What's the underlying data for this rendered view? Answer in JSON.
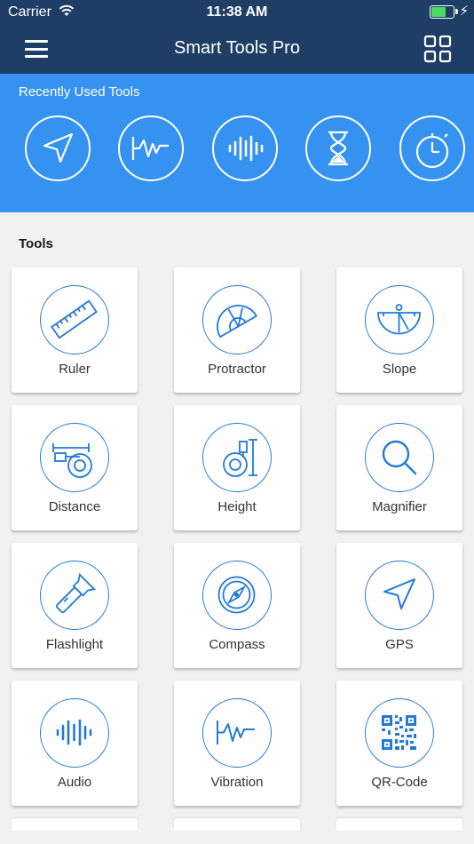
{
  "status_bar": {
    "carrier": "Carrier",
    "time": "11:38 AM",
    "battery_level": 0.75
  },
  "nav": {
    "title": "Smart Tools Pro",
    "menu_icon": "hamburger-menu-icon",
    "grid_icon": "grid-view-icon"
  },
  "recent": {
    "label": "Recently Used Tools",
    "items": [
      "gps-arrow-icon",
      "vibration-icon",
      "audio-wave-icon",
      "hourglass-icon",
      "stopwatch-icon"
    ]
  },
  "tools": {
    "heading": "Tools",
    "items": [
      {
        "label": "Ruler",
        "icon": "ruler-icon"
      },
      {
        "label": "Protractor",
        "icon": "protractor-icon"
      },
      {
        "label": "Slope",
        "icon": "slope-icon"
      },
      {
        "label": "Distance",
        "icon": "tape-measure-icon"
      },
      {
        "label": "Height",
        "icon": "height-tape-icon"
      },
      {
        "label": "Magnifier",
        "icon": "magnifier-icon"
      },
      {
        "label": "Flashlight",
        "icon": "flashlight-icon"
      },
      {
        "label": "Compass",
        "icon": "compass-icon"
      },
      {
        "label": "GPS",
        "icon": "gps-arrow-icon"
      },
      {
        "label": "Audio",
        "icon": "audio-wave-icon"
      },
      {
        "label": "Vibration",
        "icon": "vibration-icon"
      },
      {
        "label": "QR-Code",
        "icon": "qr-code-icon"
      }
    ]
  },
  "colors": {
    "nav_bg": "#1f3e66",
    "recent_bg": "#3592f0",
    "accent": "#2179d8",
    "page_bg": "#f1f1f1"
  }
}
